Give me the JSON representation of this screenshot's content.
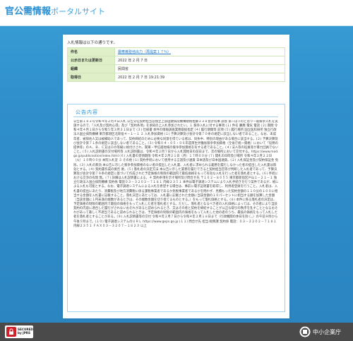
{
  "header": {
    "title_strong": "官公需情報",
    "title_sub": "ポータルサイト"
  },
  "intro": "入札情報は以下の通りです。",
  "meta": [
    {
      "label": "件名",
      "value": "慶應義塾他出力（再提案１７％）",
      "link": true
    },
    {
      "label": "公示日または更新日",
      "value": "2022 年 2 月 7 日",
      "link": false
    },
    {
      "label": "組織",
      "value": "民間省",
      "link": false
    },
    {
      "label": "取得日",
      "value": "2022 年 2 月 7 日 19:21:39",
      "link": false
    }
  ],
  "announcement": {
    "title": "公告内容",
    "body": "公告第１８２号令和４年２月４日入札 公告分任契約担当官独立上部国健病院機構規格佐藤３３８会計院事 部会 第一は下のとおり一般競争入札を実施するので、「入札及び契約心得」及び「契約条項」を承知の上入札参加されたい。１ 競争入札に付する事項 (１) 件名 慶應 電気 電話 (２) 期間 令和４年４月１日から令和５年３月３１日まで (３) 仕様書 本件の情報調査業務取扱指定 (４) 履行期間等 前項 (５) 履行場所 国立医科研所 独立行政法人国立病院機構 東京都港区北新宿４－１－１ ２ 入札参加資格 (１) 予算決算及び会計令第７０条の規定に該当しない者であること。なお、未成年者、被保佐人又は被補助人であって、契約締結のために必要な同意を得ている者は、同条中、特別の理由がある場合に該当する。(２) 予算決算及び会計令第７１条の規定に該当しない者であること。(３) 令和０４・０５・０６年度厚生労働省競争参加資格（全省庁統一資格）において「役務の提供等」のＡ、Ｂ、Ｃ又はＤの等級に格付けされ、関東・甲信越地域の競争参加資格を有する者であること。(４) 法人等の役員等が暴力団員でないこと。(５) 入札説明書の交付場所等 入札説明書は、令和４年２月７日から入札開始日の前日まで、次の場所において交付する。https://www.mod.go.jp/publicnotice/index.html (６) 入札書の受領期限 令和４年２月２１日（月）１７時００分 (７) 開札の日時及び場所 令和４年２月２２日（火）１０時００分 本院入札室 ３ その他 (１) 契約手続において使用する言語及び通貨 日本語及び日本国通貨。(２) 入札保証金及び契約保証金 免除。(３) 入札の無効 本公告に示した競争参加資格のない者の提出した入札書、入札者に求められる義務を履行しなかった者の提出した入札書は無効とする。(４) 契約書作成の要否 要。(５) 落札者の決定方法 本公告に示した業務を履行できると契約担当官等が判断した入札者であって、予算決算及び会計令第７９条の規定に基づいて作成された予定価格の制限の範囲内で最低価格をもって有効な入札を行った者を落札者とする。(６) 手続における交渉の有無 無。(７) 詳細は入札説明書による。４ 契約条項を示す場所及び問合せ先 〒１６２－８６５５ 東京都新宿区戸山１－２１－１ 独立行政法人国立病院機構 契約係 電話０３－３２０２－７１８１ 内線２３５１ 本件は電子調達システムにより入札手続きを行う案件であるが、紙による入札も可能とする。なお、電子調達システムによる入札を希望する場合は、事前に電子証明書を取得し、利用者登録を行うこと。入札者は、入札書の提出にあたり、消費税及び地方消費税に係る課税事業者であるか免税事業者であるかを問わず、見積もった契約金額の１１０分の１００に相当する金額を入札書に記載すること。落札決定にあたっては、入札書に記載された金額に当該金額の１０パーセントに相当する額を加算した金額（当該金額に１円未満の端数があるときは、その端数金額を切り捨てるものとする。）をもって落札価格とする。(８) 本件に係る落札者の決定は、予定価格の制限の範囲内で最低の価格をもって入札した者を落札者とする。ただし、落札者となるべき者の入札価格によっては、その者により当該契約の内容に適合した履行がされないおそれがあると認められるとき、又はその者と契約を締結することが公正な取引の秩序を乱すこととなるおそれがあって著しく不適当であると認められるときは、予定価格の制限の範囲内の価格をもって入札した他の者のうち、最低の価格をもって入札した者を落札者とすることがある。(９) 入札説明書等の交付 令和４年２月７日から令和４年２月１８日まで（行政機関の休日を除く。）の午前９時から午後５時まで。(１０) 電子調達システムのＵＲＬ https://www.geps.go.jp (１１) 問合せ先 担当 総務課 契約係 電話：０３－３２０２－７１８１ 内線２３５１ ＦＡＸ０３－３２０７－１８２３ 以上"
  },
  "footer": {
    "seal_line1": "SECURED",
    "seal_line2": "by JPRS",
    "org_name": "中小企業庁"
  }
}
